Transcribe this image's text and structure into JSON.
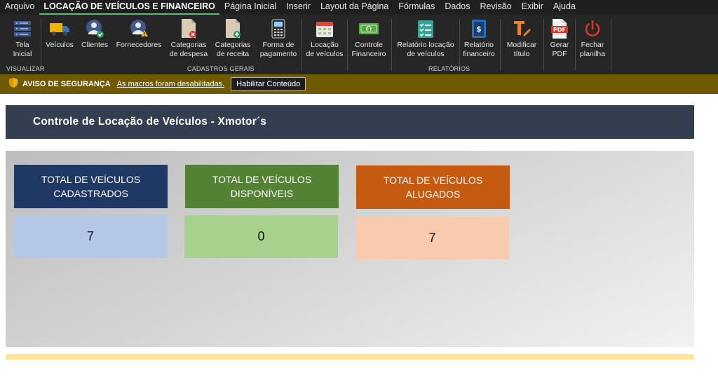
{
  "menu": {
    "items": [
      {
        "label": "Arquivo",
        "active": false
      },
      {
        "label": "LOCAÇÃO DE VEÍCULOS E FINANCEIRO",
        "active": true
      },
      {
        "label": "Página Inicial",
        "active": false
      },
      {
        "label": "Inserir",
        "active": false
      },
      {
        "label": "Layout da Página",
        "active": false
      },
      {
        "label": "Fórmulas",
        "active": false
      },
      {
        "label": "Dados",
        "active": false
      },
      {
        "label": "Revisão",
        "active": false
      },
      {
        "label": "Exibir",
        "active": false
      },
      {
        "label": "Ajuda",
        "active": false
      }
    ]
  },
  "ribbon": {
    "buttons": [
      {
        "line1": "Tela",
        "line2": "Inicial",
        "icon": "server-icon"
      },
      {
        "line1": "Veículos",
        "line2": "",
        "icon": "truck-icon"
      },
      {
        "line1": "Clientes",
        "line2": "",
        "icon": "user-check-icon"
      },
      {
        "line1": "Fornecedores",
        "line2": "",
        "icon": "user-warning-icon"
      },
      {
        "line1": "Categorias",
        "line2": "de despesa",
        "icon": "document-minus-icon"
      },
      {
        "line1": "Categorias",
        "line2": "de receita",
        "icon": "document-plus-icon"
      },
      {
        "line1": "Forma de",
        "line2": "pagamento",
        "icon": "payment-terminal-icon"
      },
      {
        "line1": "Locação",
        "line2": "de veículos",
        "icon": "calendar-icon"
      },
      {
        "line1": "Controle",
        "line2": "Financeiro",
        "icon": "money-icon"
      },
      {
        "line1": "Relatório locação",
        "line2": "de veículos",
        "icon": "checklist-icon"
      },
      {
        "line1": "Relatório",
        "line2": "financeiro",
        "icon": "financial-report-icon"
      },
      {
        "line1": "Modificar",
        "line2": "título",
        "icon": "edit-title-icon"
      },
      {
        "line1": "Gerar",
        "line2": "PDF",
        "icon": "pdf-icon"
      },
      {
        "line1": "Fechar",
        "line2": "planilha",
        "icon": "power-icon"
      }
    ],
    "groups": {
      "visualizar": "VISUALIZAR",
      "cadastros": "CADASTROS GERAIS",
      "relatorios": "RELATÓRIOS"
    },
    "pdf_badge": "PDF"
  },
  "security": {
    "title": "AVISO DE SEGURANÇA",
    "message": "As macros foram desabilitadas.",
    "button": "Habilitar Conteúdo"
  },
  "sheet": {
    "title": "Controle de Locação de Veículos - Xmotor´s",
    "cards": [
      {
        "line1": "TOTAL DE VEÍCULOS",
        "line2": "CADASTRADOS",
        "value": "7",
        "head_color": "#1f3864",
        "value_color": "#b4c7e7"
      },
      {
        "line1": "TOTAL DE VEÍCULOS",
        "line2": "DISPONÍVEIS",
        "value": "0",
        "head_color": "#548235",
        "value_color": "#a9d18e"
      },
      {
        "line1": "TOTAL DE VEÍCULOS",
        "line2": "ALUGADOS",
        "value": "7",
        "head_color": "#c55a11",
        "value_color": "#f8cbad"
      }
    ]
  }
}
